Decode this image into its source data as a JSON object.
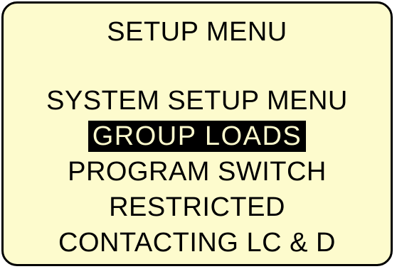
{
  "screen": {
    "title": "SETUP MENU",
    "background_color": "#fdfbcd",
    "text_color": "#000000",
    "highlight_color": "#000000"
  },
  "menu": {
    "items": [
      {
        "label": "SYSTEM SETUP MENU",
        "selected": false
      },
      {
        "label": "GROUP LOADS",
        "selected": true
      },
      {
        "label": "PROGRAM SWITCH",
        "selected": false
      },
      {
        "label": "RESTRICTED",
        "selected": false
      },
      {
        "label": "CONTACTING LC & D",
        "selected": false
      }
    ]
  }
}
